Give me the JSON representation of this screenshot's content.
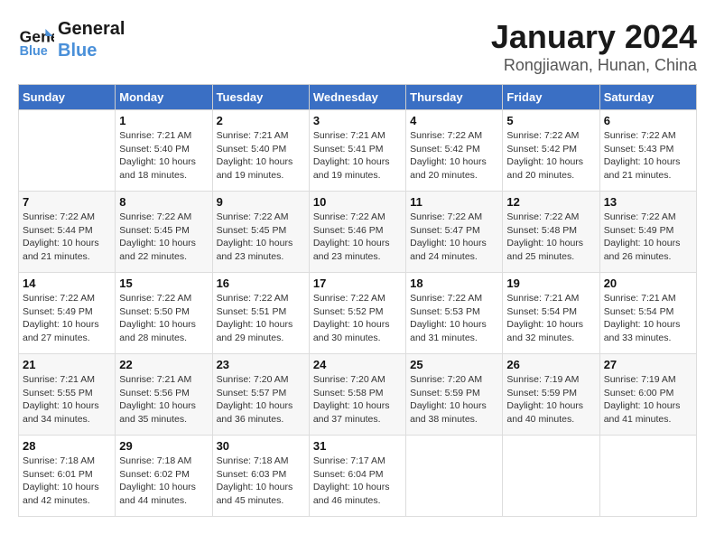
{
  "header": {
    "logo_line1": "General",
    "logo_line2": "Blue",
    "title": "January 2024",
    "subtitle": "Rongjiawan, Hunan, China"
  },
  "calendar": {
    "days_of_week": [
      "Sunday",
      "Monday",
      "Tuesday",
      "Wednesday",
      "Thursday",
      "Friday",
      "Saturday"
    ],
    "weeks": [
      [
        {
          "day": "",
          "info": ""
        },
        {
          "day": "1",
          "info": "Sunrise: 7:21 AM\nSunset: 5:40 PM\nDaylight: 10 hours\nand 18 minutes."
        },
        {
          "day": "2",
          "info": "Sunrise: 7:21 AM\nSunset: 5:40 PM\nDaylight: 10 hours\nand 19 minutes."
        },
        {
          "day": "3",
          "info": "Sunrise: 7:21 AM\nSunset: 5:41 PM\nDaylight: 10 hours\nand 19 minutes."
        },
        {
          "day": "4",
          "info": "Sunrise: 7:22 AM\nSunset: 5:42 PM\nDaylight: 10 hours\nand 20 minutes."
        },
        {
          "day": "5",
          "info": "Sunrise: 7:22 AM\nSunset: 5:42 PM\nDaylight: 10 hours\nand 20 minutes."
        },
        {
          "day": "6",
          "info": "Sunrise: 7:22 AM\nSunset: 5:43 PM\nDaylight: 10 hours\nand 21 minutes."
        }
      ],
      [
        {
          "day": "7",
          "info": "Sunrise: 7:22 AM\nSunset: 5:44 PM\nDaylight: 10 hours\nand 21 minutes."
        },
        {
          "day": "8",
          "info": "Sunrise: 7:22 AM\nSunset: 5:45 PM\nDaylight: 10 hours\nand 22 minutes."
        },
        {
          "day": "9",
          "info": "Sunrise: 7:22 AM\nSunset: 5:45 PM\nDaylight: 10 hours\nand 23 minutes."
        },
        {
          "day": "10",
          "info": "Sunrise: 7:22 AM\nSunset: 5:46 PM\nDaylight: 10 hours\nand 23 minutes."
        },
        {
          "day": "11",
          "info": "Sunrise: 7:22 AM\nSunset: 5:47 PM\nDaylight: 10 hours\nand 24 minutes."
        },
        {
          "day": "12",
          "info": "Sunrise: 7:22 AM\nSunset: 5:48 PM\nDaylight: 10 hours\nand 25 minutes."
        },
        {
          "day": "13",
          "info": "Sunrise: 7:22 AM\nSunset: 5:49 PM\nDaylight: 10 hours\nand 26 minutes."
        }
      ],
      [
        {
          "day": "14",
          "info": "Sunrise: 7:22 AM\nSunset: 5:49 PM\nDaylight: 10 hours\nand 27 minutes."
        },
        {
          "day": "15",
          "info": "Sunrise: 7:22 AM\nSunset: 5:50 PM\nDaylight: 10 hours\nand 28 minutes."
        },
        {
          "day": "16",
          "info": "Sunrise: 7:22 AM\nSunset: 5:51 PM\nDaylight: 10 hours\nand 29 minutes."
        },
        {
          "day": "17",
          "info": "Sunrise: 7:22 AM\nSunset: 5:52 PM\nDaylight: 10 hours\nand 30 minutes."
        },
        {
          "day": "18",
          "info": "Sunrise: 7:22 AM\nSunset: 5:53 PM\nDaylight: 10 hours\nand 31 minutes."
        },
        {
          "day": "19",
          "info": "Sunrise: 7:21 AM\nSunset: 5:54 PM\nDaylight: 10 hours\nand 32 minutes."
        },
        {
          "day": "20",
          "info": "Sunrise: 7:21 AM\nSunset: 5:54 PM\nDaylight: 10 hours\nand 33 minutes."
        }
      ],
      [
        {
          "day": "21",
          "info": "Sunrise: 7:21 AM\nSunset: 5:55 PM\nDaylight: 10 hours\nand 34 minutes."
        },
        {
          "day": "22",
          "info": "Sunrise: 7:21 AM\nSunset: 5:56 PM\nDaylight: 10 hours\nand 35 minutes."
        },
        {
          "day": "23",
          "info": "Sunrise: 7:20 AM\nSunset: 5:57 PM\nDaylight: 10 hours\nand 36 minutes."
        },
        {
          "day": "24",
          "info": "Sunrise: 7:20 AM\nSunset: 5:58 PM\nDaylight: 10 hours\nand 37 minutes."
        },
        {
          "day": "25",
          "info": "Sunrise: 7:20 AM\nSunset: 5:59 PM\nDaylight: 10 hours\nand 38 minutes."
        },
        {
          "day": "26",
          "info": "Sunrise: 7:19 AM\nSunset: 5:59 PM\nDaylight: 10 hours\nand 40 minutes."
        },
        {
          "day": "27",
          "info": "Sunrise: 7:19 AM\nSunset: 6:00 PM\nDaylight: 10 hours\nand 41 minutes."
        }
      ],
      [
        {
          "day": "28",
          "info": "Sunrise: 7:18 AM\nSunset: 6:01 PM\nDaylight: 10 hours\nand 42 minutes."
        },
        {
          "day": "29",
          "info": "Sunrise: 7:18 AM\nSunset: 6:02 PM\nDaylight: 10 hours\nand 44 minutes."
        },
        {
          "day": "30",
          "info": "Sunrise: 7:18 AM\nSunset: 6:03 PM\nDaylight: 10 hours\nand 45 minutes."
        },
        {
          "day": "31",
          "info": "Sunrise: 7:17 AM\nSunset: 6:04 PM\nDaylight: 10 hours\nand 46 minutes."
        },
        {
          "day": "",
          "info": ""
        },
        {
          "day": "",
          "info": ""
        },
        {
          "day": "",
          "info": ""
        }
      ]
    ]
  }
}
